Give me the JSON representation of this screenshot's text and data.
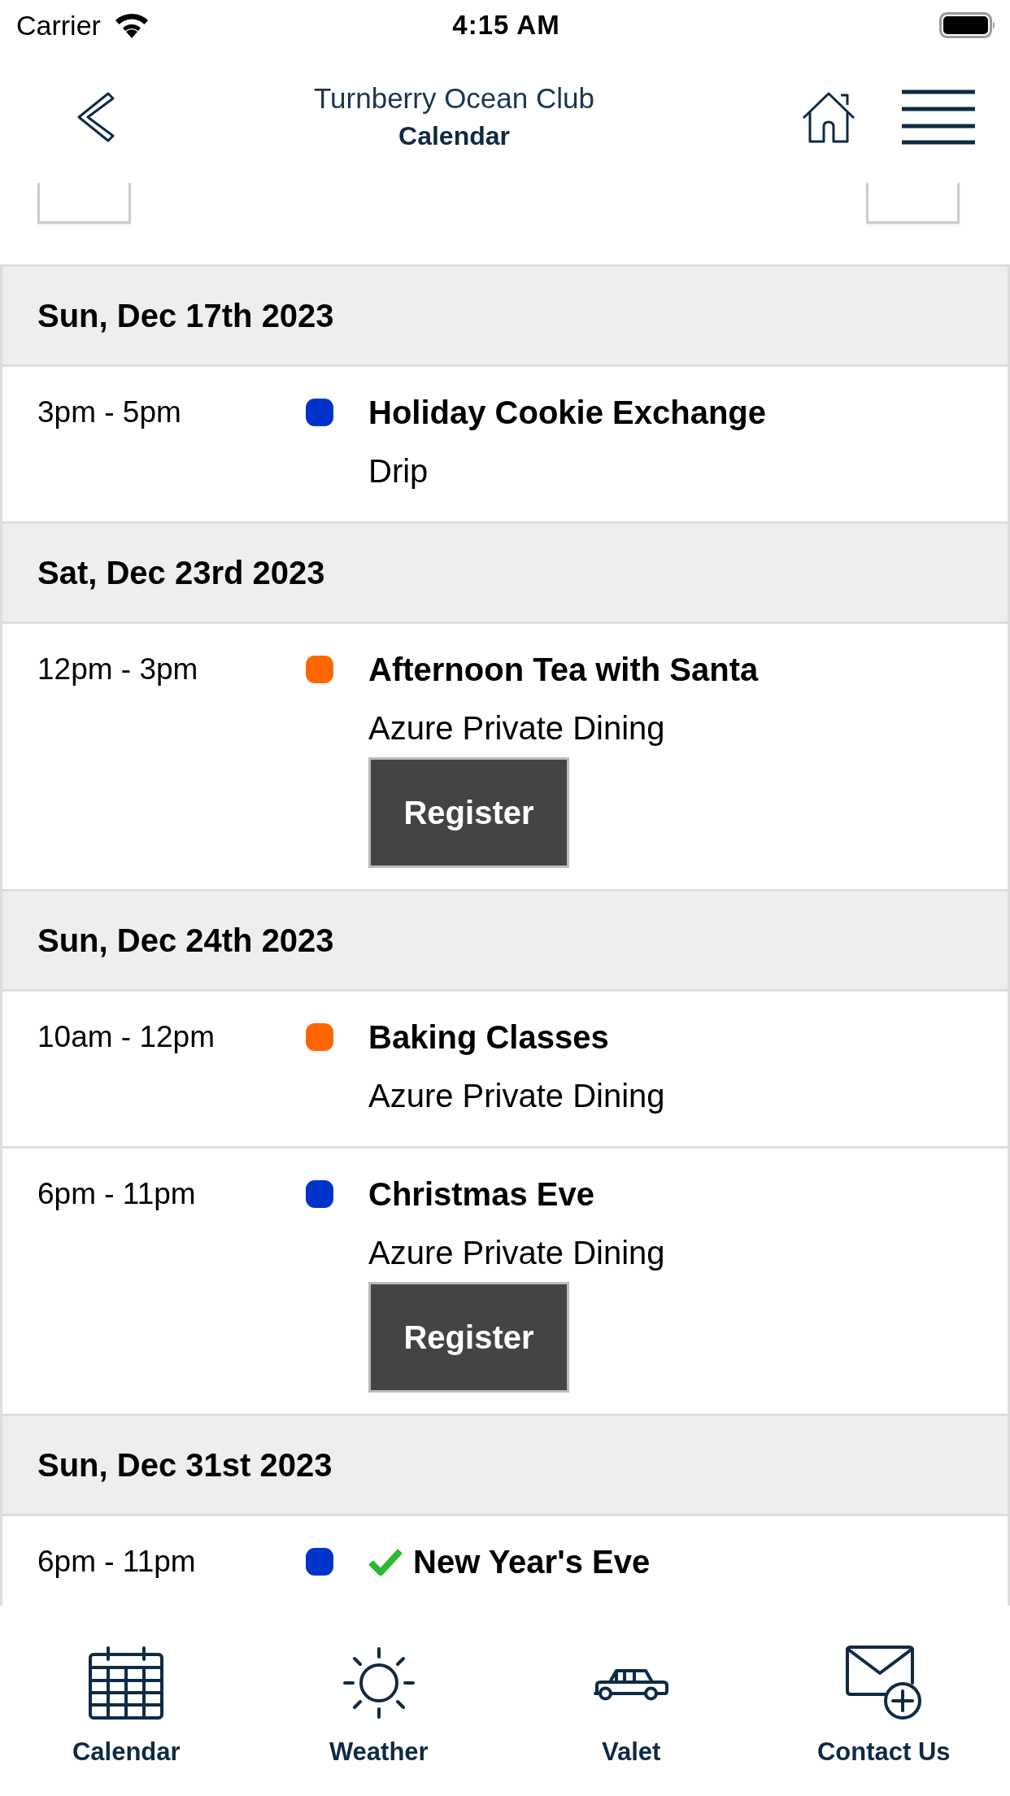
{
  "status_bar": {
    "carrier": "Carrier",
    "time": "4:15 AM"
  },
  "header": {
    "title": "Turnberry Ocean Club",
    "subtitle": "Calendar"
  },
  "days": [
    {
      "date": "Sun, Dec 17th 2023",
      "events": [
        {
          "time": "3pm - 5pm",
          "color": "#0033cc",
          "registered": false,
          "title": "Holiday Cookie Exchange",
          "location": "Drip"
        }
      ]
    },
    {
      "date": "Sat, Dec 23rd 2023",
      "events": [
        {
          "time": "12pm - 3pm",
          "color": "#ff6600",
          "registered": false,
          "title": "Afternoon Tea with Santa",
          "location": "Azure Private Dining",
          "button": "Register"
        }
      ]
    },
    {
      "date": "Sun, Dec 24th 2023",
      "events": [
        {
          "time": "10am - 12pm",
          "color": "#ff6600",
          "registered": false,
          "title": "Baking Classes",
          "location": "Azure Private Dining"
        },
        {
          "time": "6pm - 11pm",
          "color": "#0033cc",
          "registered": false,
          "title": "Christmas Eve",
          "location": "Azure Private Dining",
          "button": "Register"
        }
      ]
    },
    {
      "date": "Sun, Dec 31st 2023",
      "events": [
        {
          "time": "6pm - 11pm",
          "color": "#0033cc",
          "registered": true,
          "title": "New Year's Eve"
        }
      ]
    }
  ],
  "tab_bar": {
    "items": [
      {
        "kind": "calendar",
        "label": "Calendar"
      },
      {
        "kind": "weather",
        "label": "Weather"
      },
      {
        "kind": "valet",
        "label": "Valet"
      },
      {
        "kind": "contact",
        "label": "Contact Us"
      }
    ]
  }
}
